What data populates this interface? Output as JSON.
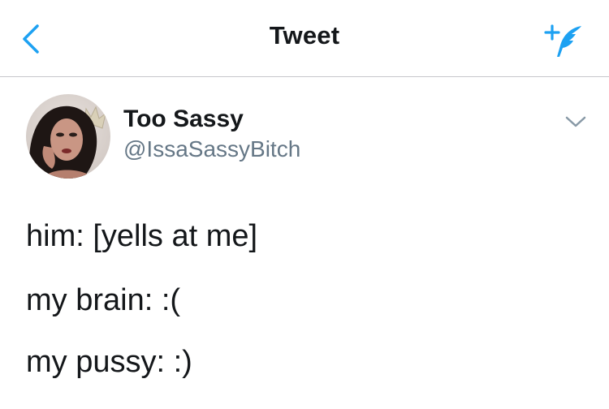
{
  "nav": {
    "title": "Tweet",
    "back_icon": "chevron-left-icon",
    "compose_icon": "compose-tweet-icon"
  },
  "tweet": {
    "author_name": "Too Sassy",
    "author_handle": "@IssaSassyBitch",
    "menu_icon": "chevron-down-icon",
    "lines": [
      "him: [yells at me]",
      "my brain:  :(",
      "my pussy:  :)"
    ]
  },
  "colors": {
    "accent": "#1da1f2",
    "text": "#14171a",
    "secondary_text": "#657786",
    "divider": "#c8c8cc"
  }
}
